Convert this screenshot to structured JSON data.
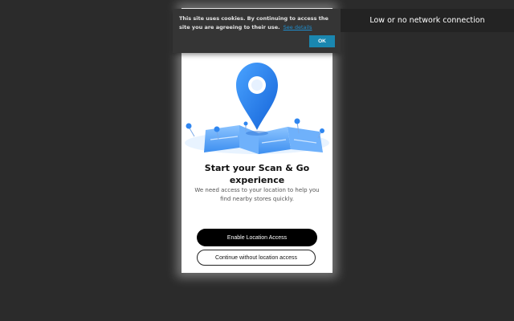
{
  "network": {
    "message": "Low or no network connection"
  },
  "cookie": {
    "text": "This site uses cookies. By continuing to access the site you are agreeing to their use.",
    "link_label": "See details",
    "ok_label": "OK"
  },
  "onboarding": {
    "hero_icon": "location-pin-map-illustration",
    "title": "Start your Scan & Go experience",
    "subtitle": "We need access to your location to help you find nearby stores quickly.",
    "enable_label": "Enable Location Access",
    "skip_label": "Continue without location access"
  },
  "colors": {
    "background": "#2b2b2b",
    "primary_button": "#000000",
    "ok_button": "#1a87b0",
    "link": "#1f8fcf",
    "pin_blue": "#2f86f0"
  }
}
